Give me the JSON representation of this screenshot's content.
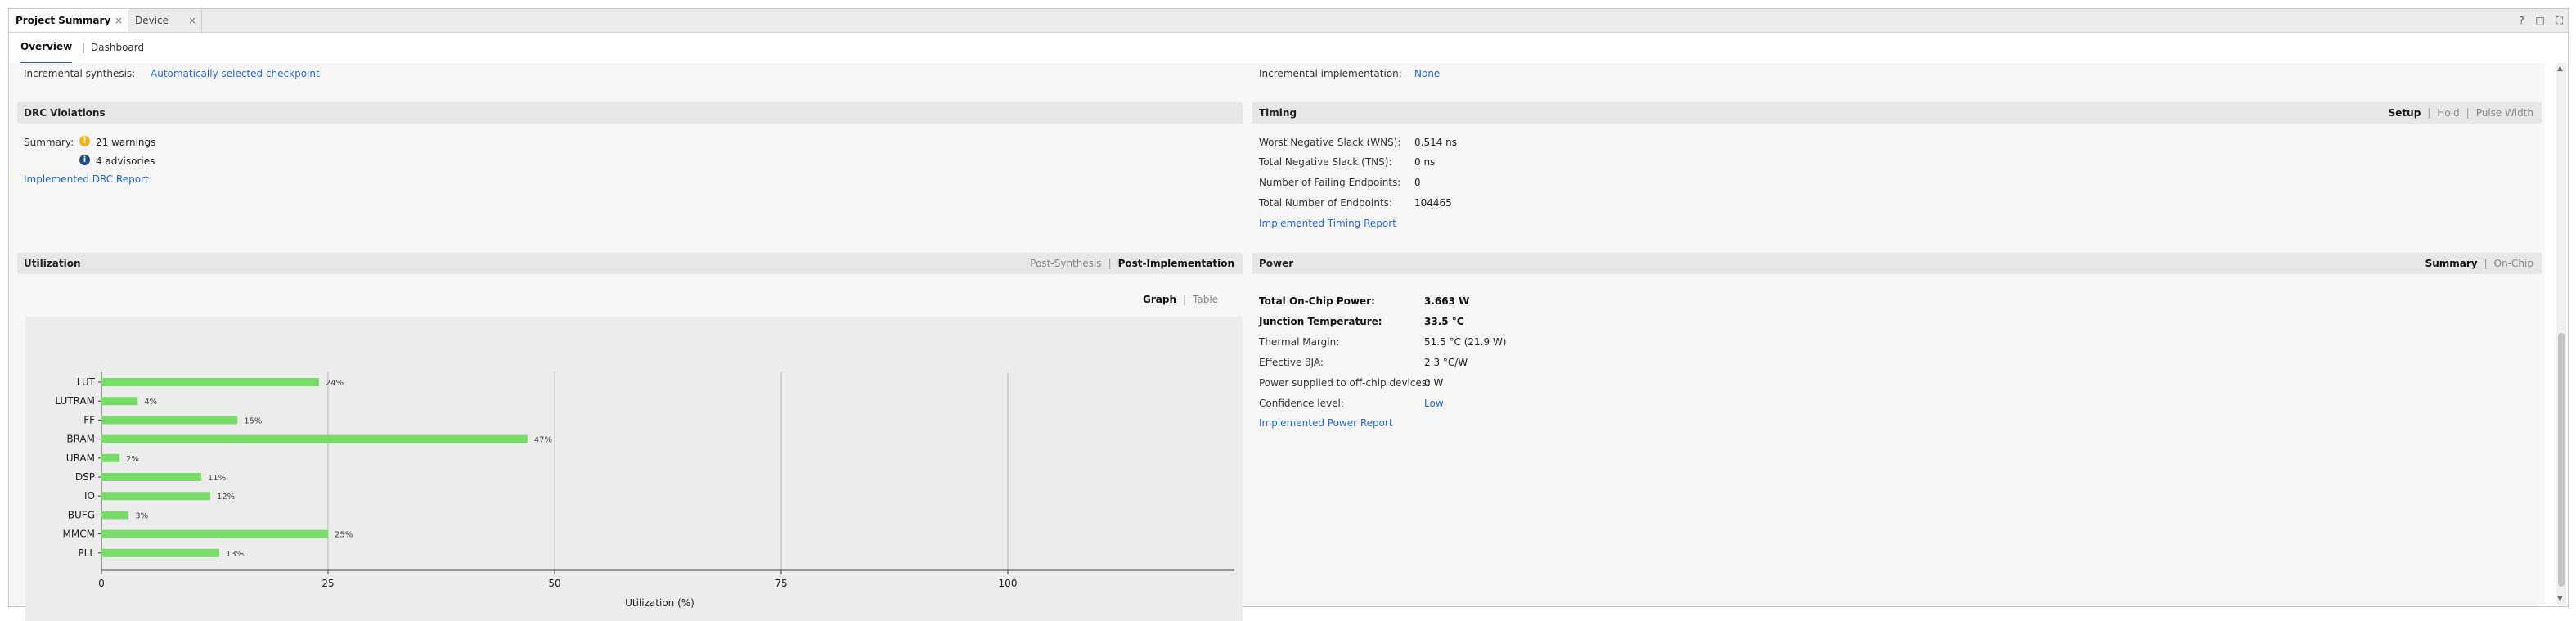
{
  "tabs": [
    {
      "label": "Project Summary",
      "close": "×"
    },
    {
      "label": "Device",
      "close": "×"
    }
  ],
  "window_icons": [
    "?",
    "□",
    "⛶"
  ],
  "subnav": {
    "overview": "Overview",
    "sep": "|",
    "dashboard": "Dashboard"
  },
  "incremental": {
    "synth_label": "Incremental synthesis:",
    "synth_value": "Automatically selected checkpoint",
    "impl_label": "Incremental implementation:",
    "impl_value": "None"
  },
  "drc": {
    "title": "DRC Violations",
    "summary_label": "Summary:",
    "warnings": "21 warnings",
    "advisories": "4 advisories",
    "report_link": "Implemented DRC Report"
  },
  "timing": {
    "title": "Timing",
    "options": [
      "Setup",
      "Hold",
      "Pulse Width"
    ],
    "rows": [
      {
        "label": "Worst Negative Slack (WNS):",
        "value": "0.514 ns"
      },
      {
        "label": "Total Negative Slack (TNS):",
        "value": "0 ns"
      },
      {
        "label": "Number of Failing Endpoints:",
        "value": "0"
      },
      {
        "label": "Total Number of Endpoints:",
        "value": "104465"
      }
    ],
    "report_link": "Implemented Timing Report"
  },
  "utilization": {
    "title": "Utilization",
    "options": [
      "Post-Synthesis",
      "Post-Implementation"
    ],
    "view_options": [
      "Graph",
      "Table"
    ]
  },
  "power": {
    "title": "Power",
    "options": [
      "Summary",
      "On-Chip"
    ],
    "rows": [
      {
        "label": "Total On-Chip Power:",
        "value": "3.663 W",
        "bold": true
      },
      {
        "label": "Junction Temperature:",
        "value": "33.5 °C",
        "bold": true
      },
      {
        "label": "Thermal Margin:",
        "value": "51.5 °C (21.9 W)",
        "bold": false
      },
      {
        "label": "Effective θJA:",
        "value": "2.3 °C/W",
        "bold": false
      },
      {
        "label": "Power supplied to off-chip devices:",
        "value": "0 W",
        "bold": false
      },
      {
        "label": "Confidence level:",
        "value": "Low",
        "bold": false,
        "link": true
      }
    ],
    "report_link": "Implemented Power Report"
  },
  "colors": {
    "bar": "#77dd66",
    "link": "#2868d8",
    "warn": "#f2b21b",
    "info": "#1d4d8f"
  },
  "chart_data": {
    "type": "bar",
    "orientation": "horizontal",
    "categories": [
      "LUT",
      "LUTRAM",
      "FF",
      "BRAM",
      "URAM",
      "DSP",
      "IO",
      "BUFG",
      "MMCM",
      "PLL"
    ],
    "values": [
      24,
      4,
      15,
      47,
      2,
      11,
      12,
      3,
      25,
      13
    ],
    "value_labels": [
      "24%",
      "4%",
      "15%",
      "47%",
      "2%",
      "11%",
      "12%",
      "3%",
      "25%",
      "13%"
    ],
    "xlabel": "Utilization (%)",
    "xlim": [
      0,
      125
    ],
    "xticks": [
      0,
      25,
      50,
      75,
      100
    ],
    "xtick_labels": [
      "0",
      "25",
      "50",
      "75",
      "100"
    ],
    "grid": true
  }
}
